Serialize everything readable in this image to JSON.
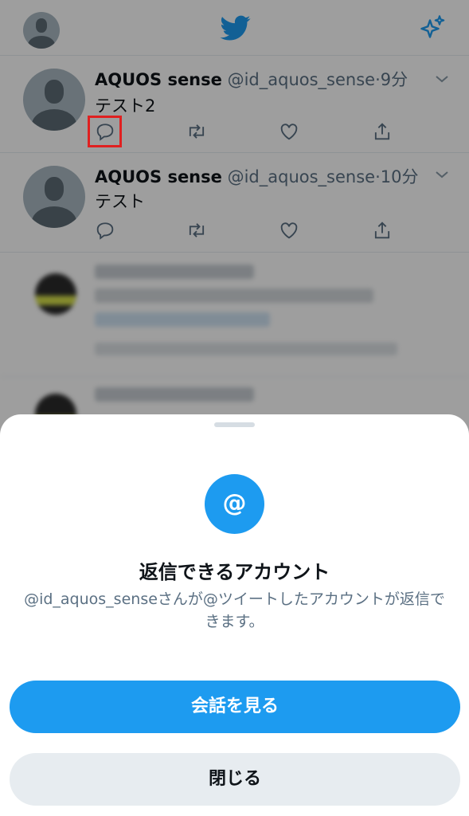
{
  "timeline": {
    "tweets": [
      {
        "name": "AQUOS sense",
        "handle": "@id_aquos_sense",
        "time": "9分",
        "text": "テスト2"
      },
      {
        "name": "AQUOS sense",
        "handle": "@id_aquos_sense",
        "time": "10分",
        "text": "テスト"
      }
    ]
  },
  "sheet": {
    "icon": "@",
    "title": "返信できるアカウント",
    "description": "@id_aquos_senseさんが@ツイートしたアカウントが返信できます。",
    "primary_button": "会話を見る",
    "secondary_button": "閉じる"
  },
  "colors": {
    "accent": "#1d9bf0",
    "highlight": "#e02020"
  }
}
